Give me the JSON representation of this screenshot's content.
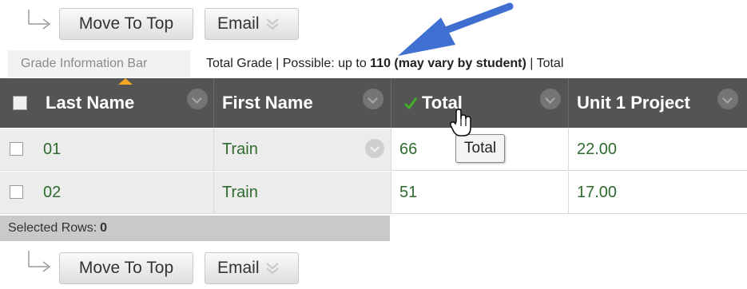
{
  "toolbar_top": {
    "move_label": "Move To Top",
    "email_label": "Email"
  },
  "toolbar_bottom": {
    "move_label": "Move To Top",
    "email_label": "Email"
  },
  "grade_info_bar": {
    "label": "Grade Information Bar",
    "prefix": "Total Grade | Possible: up to",
    "bold": "110 (may vary by student)",
    "suffix": "| Total"
  },
  "grid": {
    "columns": [
      "Last Name",
      "First Name",
      "Total",
      "Unit 1 Project"
    ],
    "rows": [
      {
        "last": "01",
        "first": "Train",
        "total": "66",
        "unit1": "22.00"
      },
      {
        "last": "02",
        "first": "Train",
        "total": "51",
        "unit1": "17.00"
      }
    ],
    "tooltip": "Total",
    "selected_rows_label": "Selected Rows:",
    "selected_rows_count": "0"
  },
  "colors": {
    "header_bg": "#545454",
    "value_green": "#2f6b2f",
    "callout_arrow": "#3f6fd0",
    "sort_indicator": "#f5a623",
    "checkmark": "#43b02a"
  },
  "icons": [
    "chevron-down-icon",
    "checkmark-icon",
    "menu-chevron-icon",
    "hand-cursor-icon",
    "arrow-indicator-icon"
  ]
}
